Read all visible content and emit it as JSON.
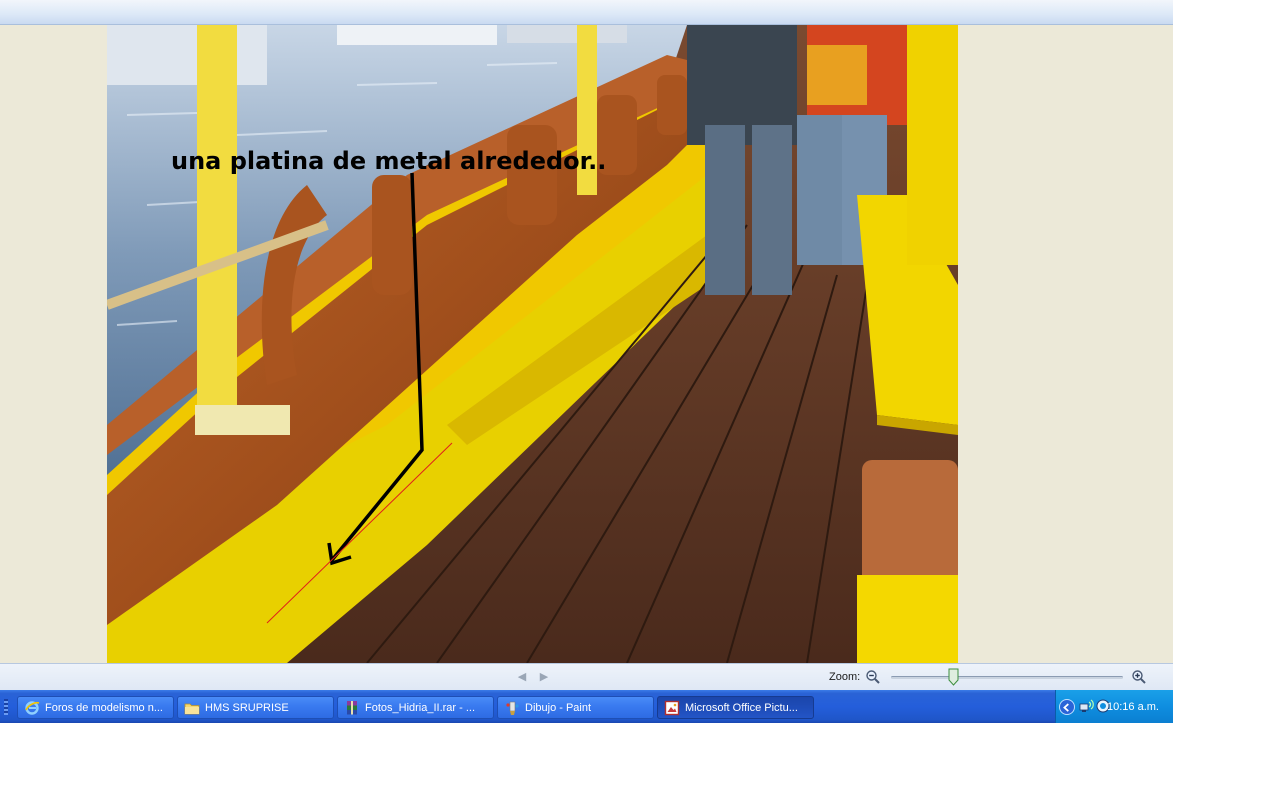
{
  "viewer": {
    "annotation_text": "una platina de metal alrededor..",
    "zoom_label": "Zoom:",
    "zoom_level": 0.27
  },
  "icons": {
    "prev": "chevron-left-icon",
    "next": "chevron-right-icon",
    "zoom_out": "zoom-out-icon",
    "zoom_in": "zoom-in-icon"
  },
  "taskbar": {
    "items": [
      {
        "label": "Foros de modelismo n...",
        "icon": "internet-explorer-icon",
        "active": false
      },
      {
        "label": "HMS SRUPRISE",
        "icon": "folder-icon",
        "active": false
      },
      {
        "label": "Fotos_Hidria_II.rar - ...",
        "icon": "winrar-icon",
        "active": false
      },
      {
        "label": "Dibujo - Paint",
        "icon": "paint-icon",
        "active": false
      },
      {
        "label": "Microsoft Office Pictu...",
        "icon": "picture-manager-icon",
        "active": true
      }
    ],
    "clock": "10:16 a.m."
  },
  "colors": {
    "taskbar": "#245edb",
    "tray": "#0f8ee0",
    "viewer_bg": "#ece9d8",
    "annotation_arrow": "#000000",
    "annotation_line": "#e0201a"
  }
}
